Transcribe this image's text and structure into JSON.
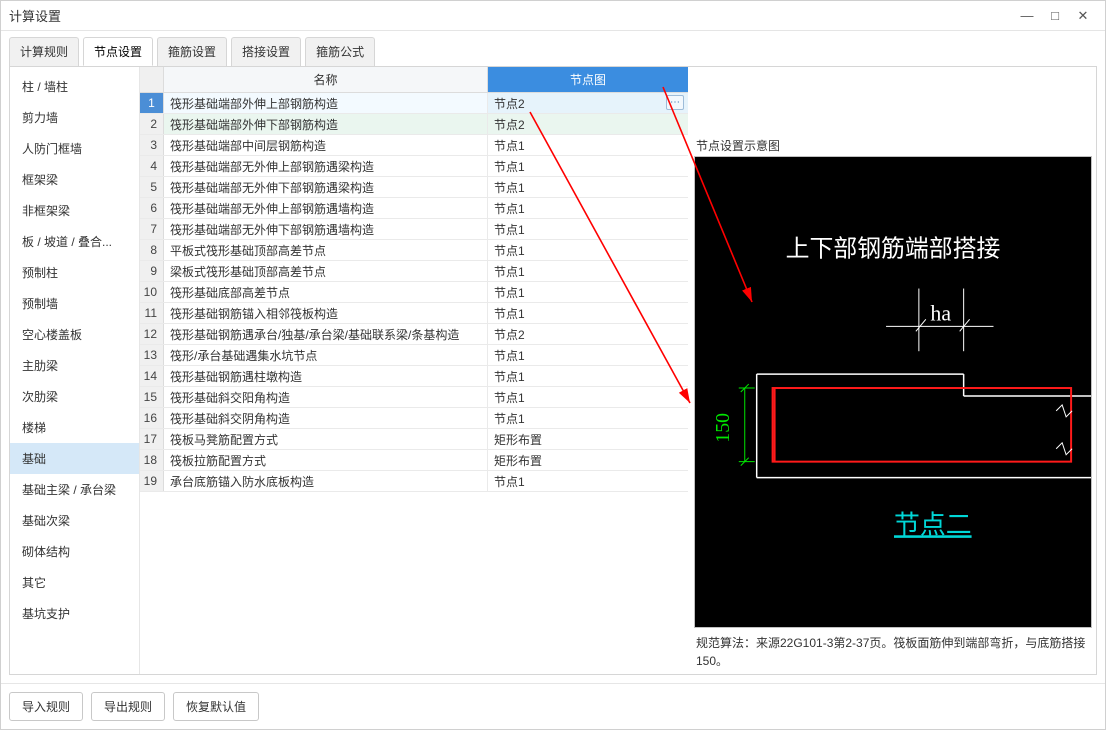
{
  "window_title": "计算设置",
  "tabs": [
    "计算规则",
    "节点设置",
    "箍筋设置",
    "搭接设置",
    "箍筋公式"
  ],
  "active_tab_index": 1,
  "sidebar": {
    "items": [
      "柱 / 墙柱",
      "剪力墙",
      "人防门框墙",
      "框架梁",
      "非框架梁",
      "板 / 坡道 / 叠合...",
      "预制柱",
      "预制墙",
      "空心楼盖板",
      "主肋梁",
      "次肋梁",
      "楼梯",
      "基础",
      "基础主梁 / 承台梁",
      "基础次梁",
      "砌体结构",
      "其它",
      "基坑支护"
    ],
    "selected_index": 12
  },
  "table": {
    "headers": {
      "rownum": "",
      "name": "名称",
      "node": "节点图"
    },
    "rows": [
      {
        "name": "筏形基础端部外伸上部钢筋构造",
        "node": "节点2"
      },
      {
        "name": "筏形基础端部外伸下部钢筋构造",
        "node": "节点2"
      },
      {
        "name": "筏形基础端部中间层钢筋构造",
        "node": "节点1"
      },
      {
        "name": "筏形基础端部无外伸上部钢筋遇梁构造",
        "node": "节点1"
      },
      {
        "name": "筏形基础端部无外伸下部钢筋遇梁构造",
        "node": "节点1"
      },
      {
        "name": "筏形基础端部无外伸上部钢筋遇墙构造",
        "node": "节点1"
      },
      {
        "name": "筏形基础端部无外伸下部钢筋遇墙构造",
        "node": "节点1"
      },
      {
        "name": "平板式筏形基础顶部高差节点",
        "node": "节点1"
      },
      {
        "name": "梁板式筏形基础顶部高差节点",
        "node": "节点1"
      },
      {
        "name": "筏形基础底部高差节点",
        "node": "节点1"
      },
      {
        "name": "筏形基础钢筋锚入相邻筏板构造",
        "node": "节点1"
      },
      {
        "name": "筏形基础钢筋遇承台/独基/承台梁/基础联系梁/条基构造",
        "node": "节点2"
      },
      {
        "name": "筏形/承台基础遇集水坑节点",
        "node": "节点1"
      },
      {
        "name": "筏形基础钢筋遇柱墩构造",
        "node": "节点1"
      },
      {
        "name": "筏形基础斜交阳角构造",
        "node": "节点1"
      },
      {
        "name": "筏形基础斜交阴角构造",
        "node": "节点1"
      },
      {
        "name": "筏板马凳筋配置方式",
        "node": "矩形布置"
      },
      {
        "name": "筏板拉筋配置方式",
        "node": "矩形布置"
      },
      {
        "name": "承台底筋锚入防水底板构造",
        "node": "节点1"
      }
    ]
  },
  "node_edit_icon": "⋯",
  "diagram": {
    "panel_title": "节点设置示意图",
    "title": "上下部钢筋端部搭接",
    "ha": "ha",
    "dim_150": "150",
    "node_label": "节点二"
  },
  "description": "规范算法：来源22G101-3第2-37页。筏板面筋伸到端部弯折，与底筋搭接 150。",
  "footer": {
    "import": "导入规则",
    "export": "导出规则",
    "restore": "恢复默认值"
  }
}
